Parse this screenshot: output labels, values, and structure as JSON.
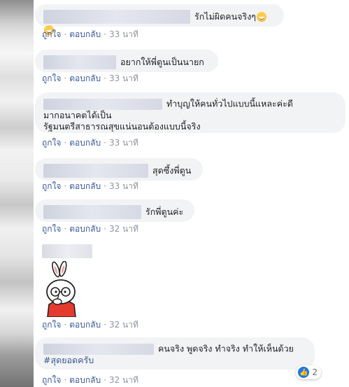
{
  "comments": [
    {
      "text": "รักไม่ผิดคนจริงๆ",
      "like": "ถูกใจ",
      "reply": "ตอบกลับ",
      "time": "33 นาที",
      "emoji": [
        "grin-emoji",
        "grin-emoji"
      ]
    },
    {
      "text": "อยากให้พี่ตูนเป็นนายก",
      "like": "ถูกใจ",
      "reply": "ตอบกลับ",
      "time": "33 นาที"
    },
    {
      "text_line1": "ทำบุญให้คนทั่วไปแบบนี้แหละค่ะดี",
      "text_line2": "มากอนาคตได้เป็น",
      "text_line3": "รัฐมนตรีสาธารณสุขแน่นอนต้องแบบนี้จริง",
      "like": "ถูกใจ",
      "reply": "ตอบกลับ",
      "time": "33 นาที"
    },
    {
      "text": "สุดซึ้งพี่ตูน",
      "like": "ถูกใจ",
      "reply": "ตอบกลับ",
      "time": "33 นาที"
    },
    {
      "text": "รักพี่ตูนค่ะ",
      "like": "ถูกใจ",
      "reply": "ตอบกลับ",
      "time": "32 นาที"
    },
    {
      "sticker": "cartoon-sticker",
      "like": "ถูกใจ",
      "reply": "ตอบกลับ",
      "time": "32 นาที"
    },
    {
      "text_line1": "คนจริง พูดจริง ทำจริง ทำให้เห็นด้วย",
      "text_line2": "#สุดยอดครับ",
      "like": "ถูกใจ",
      "reply": "ตอบกลับ",
      "time": "32 นาที",
      "reaction_count": "2"
    }
  ],
  "separator": "·",
  "colors": {
    "link": "#385898",
    "hashtag": "#385898",
    "meta": "#90949c",
    "bubble": "#f2f3f5",
    "like_blue": "#1877f2"
  }
}
